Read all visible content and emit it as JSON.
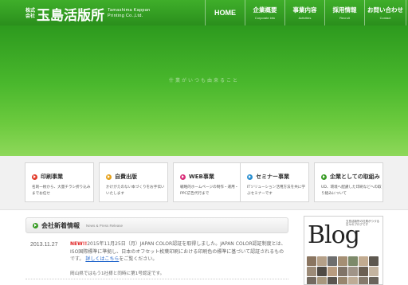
{
  "header": {
    "logo": {
      "kk_line1": "株式",
      "kk_line2": "会社",
      "name": "玉島活版所",
      "en_line1": "Tamashima Kappan",
      "en_line2": "Printing Co.,Ltd."
    },
    "nav": [
      {
        "label": "HOME",
        "sub": ""
      },
      {
        "label": "企業概要",
        "sub": "Corporate info"
      },
      {
        "label": "事業内容",
        "sub": "Activities"
      },
      {
        "label": "採用情報",
        "sub": "Recruit"
      },
      {
        "label": "お問い合わせ",
        "sub": "Contact"
      }
    ]
  },
  "hero": {
    "tagline": "什業がいつも由来ること"
  },
  "services": [
    {
      "title": "印刷事業",
      "desc": "名刺一枚から、大量チラシ折り込みまでお任せ",
      "icon": "arrow-icon",
      "color": "#e23b2a"
    },
    {
      "title": "自費出版",
      "desc": "かけがえのない本づくりをお手伝いいたします",
      "icon": "arrow-icon",
      "color": "#e6a11b"
    },
    {
      "title": "WEB事業",
      "desc": "戦略的ホームページの制作・運用・PPC広告代行まで",
      "icon": "arrow-icon",
      "color": "#d9307a"
    },
    {
      "title": "セミナー事業",
      "desc": "ITソリューション活用方法を共に学ぶセミナーです",
      "icon": "arrow-icon",
      "color": "#2a8fd0"
    },
    {
      "title": "企業としての取組み",
      "desc": "UD、環境へ配慮した印刷などへの取り組みについて",
      "icon": "arrow-icon",
      "color": "#3a9c27"
    }
  ],
  "news": {
    "title": "会社新着情報",
    "title_en": "News & Press Release",
    "items": [
      {
        "date": "2013.11.27",
        "badge": "NEW!!",
        "text": "2015年11月25日（月）JAPAN COLOR認証を取得しました。JAPAN COLOR認証制度とは、ISO国際標準に準拠し、日本のオフセット枚葉印刷における印刷色の標準に基づいて認証されるものです。",
        "link": "詳しくはこちら",
        "tail": "をご覧ください。",
        "more": "岡山県ではもう1社様と同時に第1号認定です。"
      }
    ]
  },
  "blog": {
    "word": "Blog",
    "tagline": "玉島活版所の社員がつづる日々のブログです"
  },
  "colors": {
    "brand_green": "#2f9a20",
    "new_red": "#e02020",
    "link_blue": "#2266cc"
  }
}
